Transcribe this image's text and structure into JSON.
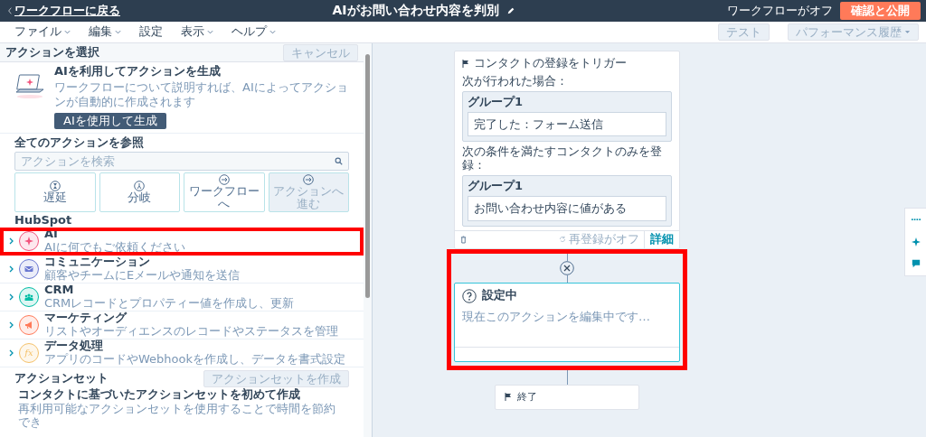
{
  "topbar": {
    "back_link": "ワークフローに戻る",
    "title": "AIがお問い合わせ内容を判別",
    "status": "ワークフローがオフ",
    "publish_button": "確認と公開"
  },
  "menu": [
    {
      "label": "ファイル",
      "dropdown": true
    },
    {
      "label": "編集",
      "dropdown": true
    },
    {
      "label": "設定",
      "dropdown": false
    },
    {
      "label": "表示",
      "dropdown": true
    },
    {
      "label": "ヘルプ",
      "dropdown": true
    }
  ],
  "toolbar": {
    "test_button": "テスト",
    "history_button": "パフォーマンス履歴"
  },
  "sidebar": {
    "title": "アクションを選択",
    "cancel_button": "キャンセル",
    "ai_promo": {
      "title": "AIを利用してアクションを生成",
      "description": "ワークフローについて説明すれば、AIによってアクションが自動的に作成されます",
      "button": "AIを使用して生成"
    },
    "browse_title": "全てのアクションを参照",
    "search": {
      "placeholder": "アクションを検索"
    },
    "quick_actions": [
      {
        "label": "遅延",
        "disabled": false
      },
      {
        "label": "分岐",
        "disabled": false
      },
      {
        "label": "ワークフローへ",
        "disabled": false
      },
      {
        "label": "アクションへ進む",
        "disabled": true
      }
    ],
    "section_title": "HubSpot",
    "categories": [
      {
        "title": "AI",
        "description": "AIに何でもご依頼ください",
        "color": "#f2547d",
        "highlighted": true
      },
      {
        "title": "コミュニケーション",
        "description": "顧客やチームにEメールや通知を送信",
        "color": "#6a78d1",
        "highlighted": false
      },
      {
        "title": "CRM",
        "description": "CRMレコードとプロパティー値を作成し、更新",
        "color": "#00bda5",
        "highlighted": false
      },
      {
        "title": "マーケティング",
        "description": "リストやオーディエンスのレコードやステータスを管理",
        "color": "#ff7a59",
        "highlighted": false
      },
      {
        "title": "データ処理",
        "description": "アプリのコードやWebhookを作成し、データを書式設定",
        "glyph": "fx",
        "color": "#f5c26b",
        "highlighted": false
      }
    ],
    "action_sets": {
      "title": "アクションセット",
      "create_button": "アクションセットを作成",
      "heading": "コンタクトに基づいたアクションセットを初めて作成",
      "description": "再利用可能なアクションセットを使用することで時間を節約でき"
    }
  },
  "canvas": {
    "trigger": {
      "title": "コンタクトの登録をトリガー",
      "sections": [
        {
          "label": "次が行われた場合：",
          "group_title": "グループ1",
          "condition": "完了した：フォーム送信"
        },
        {
          "label": "次の条件を満たすコンタクトのみを登録：",
          "group_title": "グループ1",
          "condition": "お問い合わせ内容に値がある"
        }
      ],
      "reenroll": "再登録がオフ",
      "details_link": "詳細"
    },
    "editing_node": {
      "title": "設定中",
      "message": "現在このアクションを編集中です…",
      "highlighted": true
    },
    "end_node": {
      "label": "終了"
    }
  }
}
